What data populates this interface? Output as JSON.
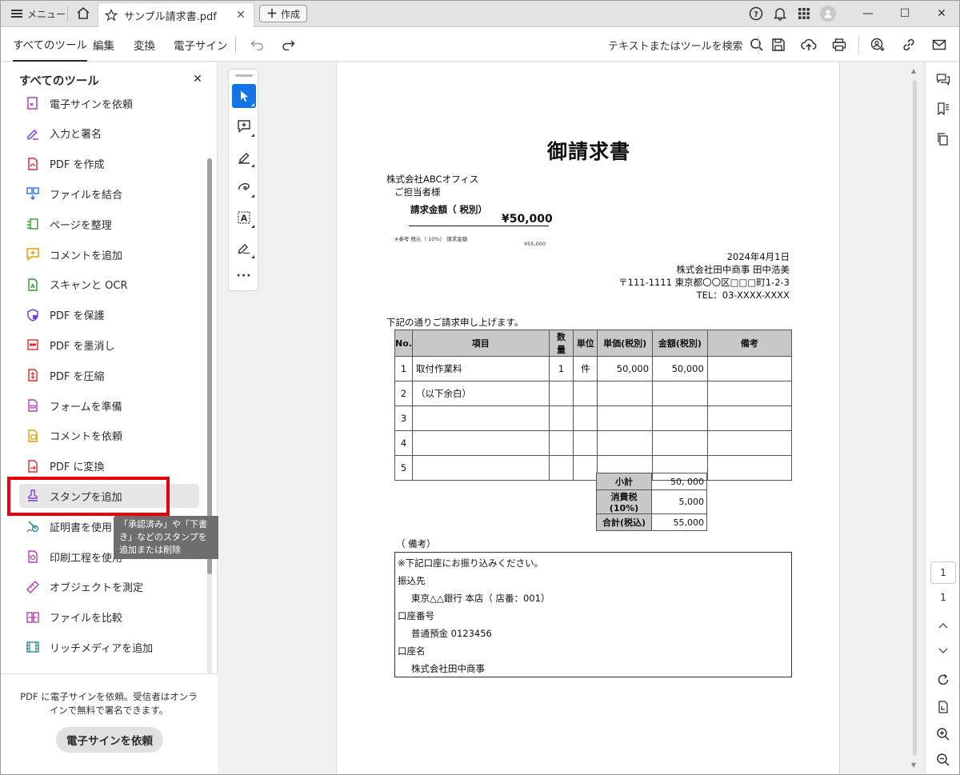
{
  "titlebar": {
    "menu_label": "メニュー",
    "tab_title": "サンプル請求書.pdf",
    "create_label": "作成"
  },
  "toolbar": {
    "tabs": [
      "すべてのツール",
      "編集",
      "変換",
      "電子サイン"
    ],
    "search_label": "テキストまたはツールを検索"
  },
  "left_panel": {
    "title": "すべてのツール",
    "items": [
      {
        "label": "電子サインを依頼",
        "icon": "sign-request-icon",
        "color": "#b33fb6"
      },
      {
        "label": "入力と署名",
        "icon": "fill-sign-icon",
        "color": "#7b3fe4"
      },
      {
        "label": "PDF を作成",
        "icon": "create-pdf-icon",
        "color": "#e3282b"
      },
      {
        "label": "ファイルを結合",
        "icon": "combine-files-icon",
        "color": "#2d6de3"
      },
      {
        "label": "ページを整理",
        "icon": "organize-pages-icon",
        "color": "#2f9a2f"
      },
      {
        "label": "コメントを追加",
        "icon": "add-comment-icon",
        "color": "#e0a100"
      },
      {
        "label": "スキャンと OCR",
        "icon": "scan-ocr-icon",
        "color": "#2f9a2f"
      },
      {
        "label": "PDF を保護",
        "icon": "protect-pdf-icon",
        "color": "#7b3fe4"
      },
      {
        "label": "PDF を墨消し",
        "icon": "redact-pdf-icon",
        "color": "#e3282b"
      },
      {
        "label": "PDF を圧縮",
        "icon": "compress-pdf-icon",
        "color": "#e3282b"
      },
      {
        "label": "フォームを準備",
        "icon": "prepare-form-icon",
        "color": "#b33fb6"
      },
      {
        "label": "コメントを依頼",
        "icon": "request-comment-icon",
        "color": "#e0a100"
      },
      {
        "label": "PDF に変換",
        "icon": "convert-pdf-icon",
        "color": "#e3282b"
      },
      {
        "label": "スタンプを追加",
        "icon": "stamp-icon",
        "color": "#7b3fe4"
      },
      {
        "label": "証明書を使用",
        "icon": "certificate-icon",
        "color": "#2f8a8a"
      },
      {
        "label": "印刷工程を使用",
        "icon": "print-production-icon",
        "color": "#b33fb6"
      },
      {
        "label": "オブジェクトを測定",
        "icon": "measure-icon",
        "color": "#b33fb6"
      },
      {
        "label": "ファイルを比較",
        "icon": "compare-files-icon",
        "color": "#b33fb6"
      },
      {
        "label": "リッチメディアを追加",
        "icon": "rich-media-icon",
        "color": "#2f8a8a"
      }
    ],
    "tooltip": "「承認済み」や「下書き」などのスタンプを追加または削除",
    "promo_text": "PDF に電子サインを依頼。受信者はオンラインで無料で署名できます。",
    "promo_button": "電子サインを依頼"
  },
  "document": {
    "title": "御請求書",
    "recipient_company": "株式会社ABCオフィス",
    "recipient_person": "ご担当者様",
    "amount_label": "請求金額（ 税別）",
    "amount_value": "¥50,000",
    "tax_note": "※参考 税込（ 10%） 請求金額",
    "tax_note_value": "¥55,000",
    "date": "2024年4月1日",
    "issuer": "株式会社田中商事 田中浩美",
    "address": "〒111-1111 東京都〇〇区□□□町1-2-3",
    "tel": "TEL：03-XXXX-XXXX",
    "intro": "下記の通りご請求申し上げます。",
    "table_headers": [
      "No.",
      "項目",
      "数量",
      "単位",
      "単価(税別)",
      "金額(税別)",
      "備考"
    ],
    "rows": [
      [
        "1",
        "取付作業料",
        "1",
        "件",
        "50,000",
        "50,000",
        ""
      ],
      [
        "2",
        "（以下余白）",
        "",
        "",
        "",
        "",
        ""
      ],
      [
        "3",
        "",
        "",
        "",
        "",
        "",
        ""
      ],
      [
        "4",
        "",
        "",
        "",
        "",
        "",
        ""
      ],
      [
        "5",
        "",
        "",
        "",
        "",
        "",
        ""
      ]
    ],
    "summary": [
      {
        "label": "小計",
        "value": "50, 000"
      },
      {
        "label": "消費税(10%)",
        "value": "5,000"
      },
      {
        "label": "合計(税込)",
        "value": "55,000"
      }
    ],
    "remarks_heading": "（ 備考）",
    "remarks": {
      "line1": "※下記口座にお振り込みください。",
      "transfer_label": "振込先",
      "bank": "東京△△銀行 本店（ 店番：001）",
      "account_no_label": "口座番号",
      "account_no": "普通預金 0123456",
      "account_name_label": "口座名",
      "account_name": "株式会社田中商事"
    }
  },
  "pager": {
    "current": "1",
    "total": "1"
  },
  "colors": {
    "accent_blue": "#1473e6",
    "highlight_red": "#e6000e",
    "tooltip_bg": "#6e6e6e"
  }
}
